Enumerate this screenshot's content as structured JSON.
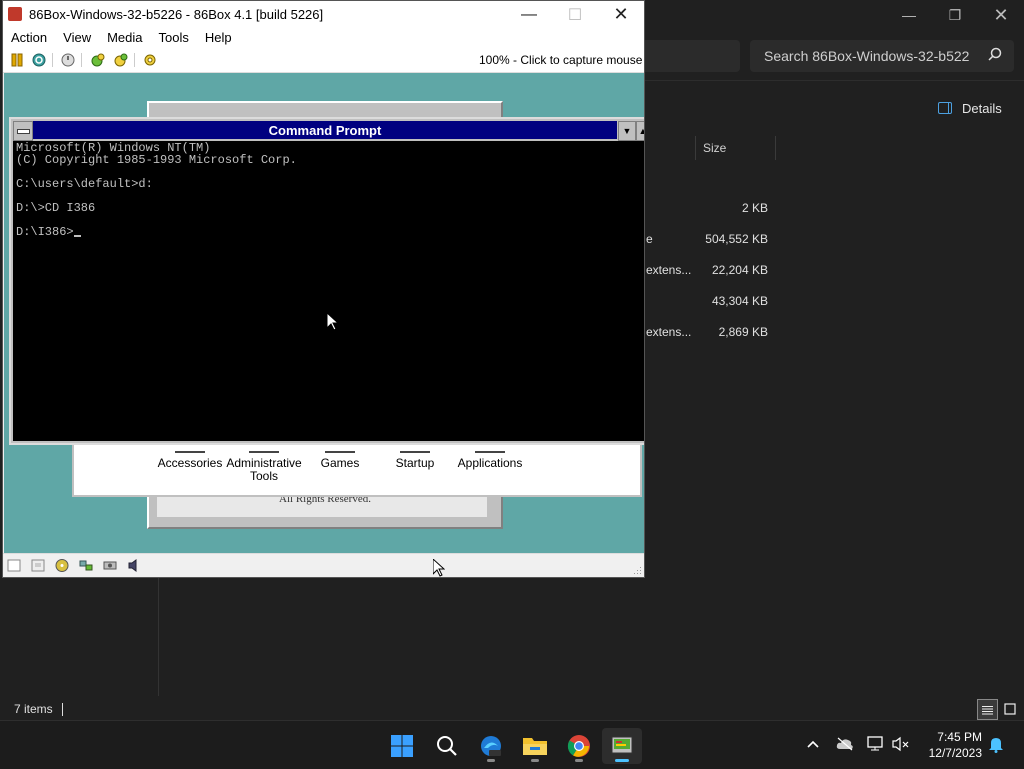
{
  "explorer": {
    "search_placeholder": "Search 86Box-Windows-32-b5226",
    "details_label": "Details",
    "column_size": "Size",
    "rows": [
      {
        "type": "",
        "size": "2 KB"
      },
      {
        "type": "e",
        "size": "504,552 KB"
      },
      {
        "type": "extens...",
        "size": "22,204 KB"
      },
      {
        "type": "",
        "size": "43,304 KB"
      },
      {
        "type": "extens...",
        "size": "2,869 KB"
      }
    ],
    "status_items": "7 items"
  },
  "box": {
    "title": "86Box-Windows-32-b5226 - 86Box 4.1 [build 5226]",
    "menu": [
      "Action",
      "View",
      "Media",
      "Tools",
      "Help"
    ],
    "capture_text": "100% - Click to capture mouse"
  },
  "nt": {
    "cmd_title": "Command Prompt",
    "cmd_lines": [
      "Microsoft(R) Windows NT(TM)",
      "(C) Copyright 1985-1993 Microsoft Corp.",
      "",
      "C:\\users\\default>d:",
      "",
      "D:\\>CD I386",
      "",
      "D:\\I386>"
    ],
    "groups": [
      {
        "label": "Accessories"
      },
      {
        "label": "Administrative Tools"
      },
      {
        "label": "Games"
      },
      {
        "label": "Startup"
      },
      {
        "label": "Applications"
      }
    ],
    "rights_text": "All Rights Reserved."
  },
  "taskbar": {
    "time": "7:45 PM",
    "date": "12/7/2023",
    "accent": "#4cc2ff"
  }
}
